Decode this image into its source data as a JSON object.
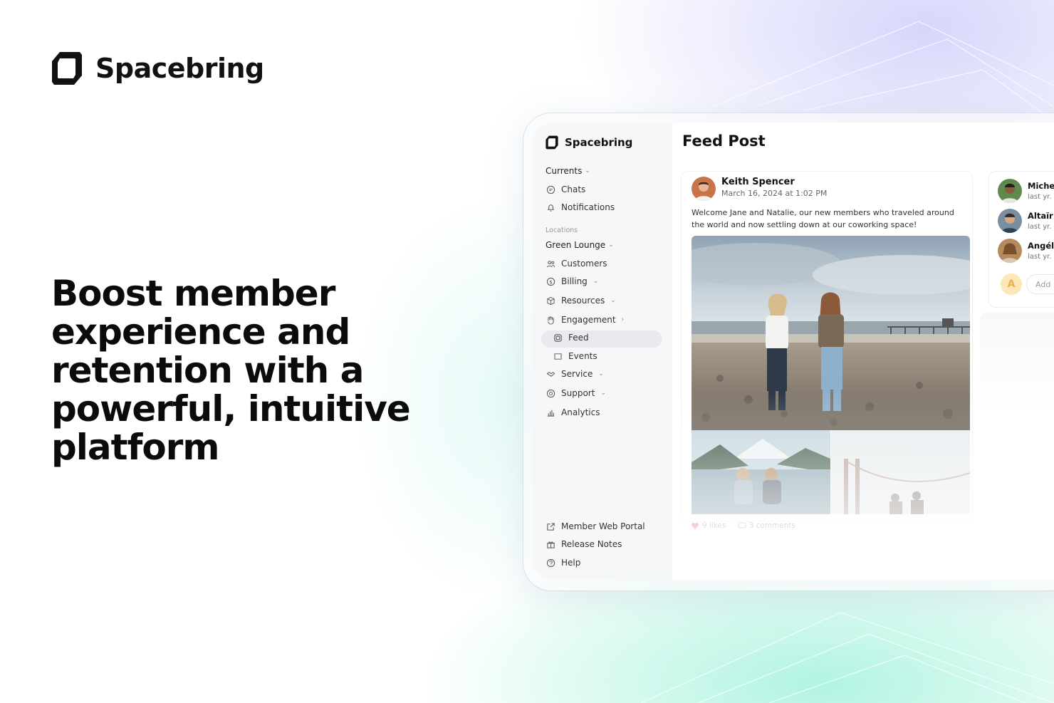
{
  "brand": {
    "name": "Spacebring"
  },
  "headline": "Boost member experience and retention with a powerful, intuitive platform",
  "app": {
    "brand_name": "Spacebring",
    "page_title": "Feed Post",
    "sidebar": {
      "currents_label": "Currents",
      "chats": "Chats",
      "notifications": "Notifications",
      "locations_caption": "Locations",
      "location_name": "Green Lounge",
      "customers": "Customers",
      "billing": "Billing",
      "resources": "Resources",
      "engagement": "Engagement",
      "feed": "Feed",
      "events": "Events",
      "service": "Service",
      "support": "Support",
      "analytics": "Analytics",
      "member_web_portal": "Member Web Portal",
      "release_notes": "Release Notes",
      "help": "Help"
    },
    "post": {
      "author": "Keith Spencer",
      "date": "March 16, 2024 at 1:02 PM",
      "text": "Welcome Jane and Natalie, our new members who traveled around the world and now settling down at our coworking space!",
      "likes": "9 likes",
      "comments": "3 comments"
    },
    "side_panel": {
      "rows": [
        {
          "name": "Michel",
          "time": "last yr."
        },
        {
          "name": "Altaïr A",
          "time": "last yr."
        },
        {
          "name": "Angéli",
          "time": "last yr."
        }
      ],
      "add_avatar_letter": "A",
      "add_placeholder": "Add"
    }
  },
  "colors": {
    "accent_active": "#e8eaed",
    "avatar_add": "#fde7b8",
    "bg_top_tint": "#c8c8fa",
    "bg_bottom_tint": "#96f0d7"
  },
  "icons": [
    "brand-logo-icon",
    "chat-icon",
    "bell-icon",
    "customers-icon",
    "billing-icon",
    "resources-icon",
    "engagement-icon",
    "feed-icon",
    "events-icon",
    "service-icon",
    "support-icon",
    "analytics-icon",
    "external-link-icon",
    "gift-icon",
    "help-icon",
    "heart-icon",
    "comment-icon"
  ]
}
